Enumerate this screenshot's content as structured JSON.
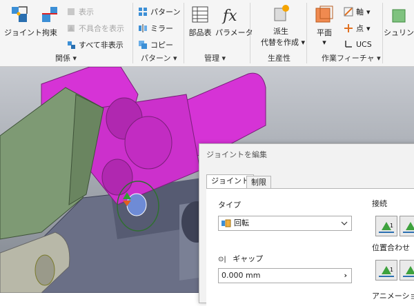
{
  "ribbon": {
    "groups": {
      "relations": "関係",
      "pattern": "パターン",
      "manage": "管理",
      "productivity": "生産性",
      "work_features": "作業フィーチャ"
    },
    "joint": "ジョイント",
    "constraint": "拘束",
    "show": "表示",
    "show_problems": "不具合を表示",
    "hide_all": "すべて非表示",
    "pattern": "パターン",
    "mirror": "ミラー",
    "copy": "コピー",
    "bom": "部品表",
    "parameters": "パラメータ",
    "derive_line1": "派生",
    "derive_line2": "代替を作成",
    "plane": "平面",
    "axis": "軸",
    "point": "点",
    "ucs": "UCS",
    "shrinkwrap": "シュリンク"
  },
  "dialog": {
    "title": "ジョイントを編集",
    "tabs": [
      "ジョイント",
      "制限"
    ],
    "type_label": "タイプ",
    "type_value": "回転",
    "gap_label": "ギャップ",
    "gap_value": "0.000 mm",
    "connect_label": "接続",
    "align_label": "位置合わせ",
    "anim_label": "アニメーション",
    "btn_num": "1"
  },
  "colors": {
    "magenta": "#d633d6",
    "green_part": "#7e9a74",
    "base": "#6a6f86",
    "ribbon_bg": "#f5f5f5"
  }
}
